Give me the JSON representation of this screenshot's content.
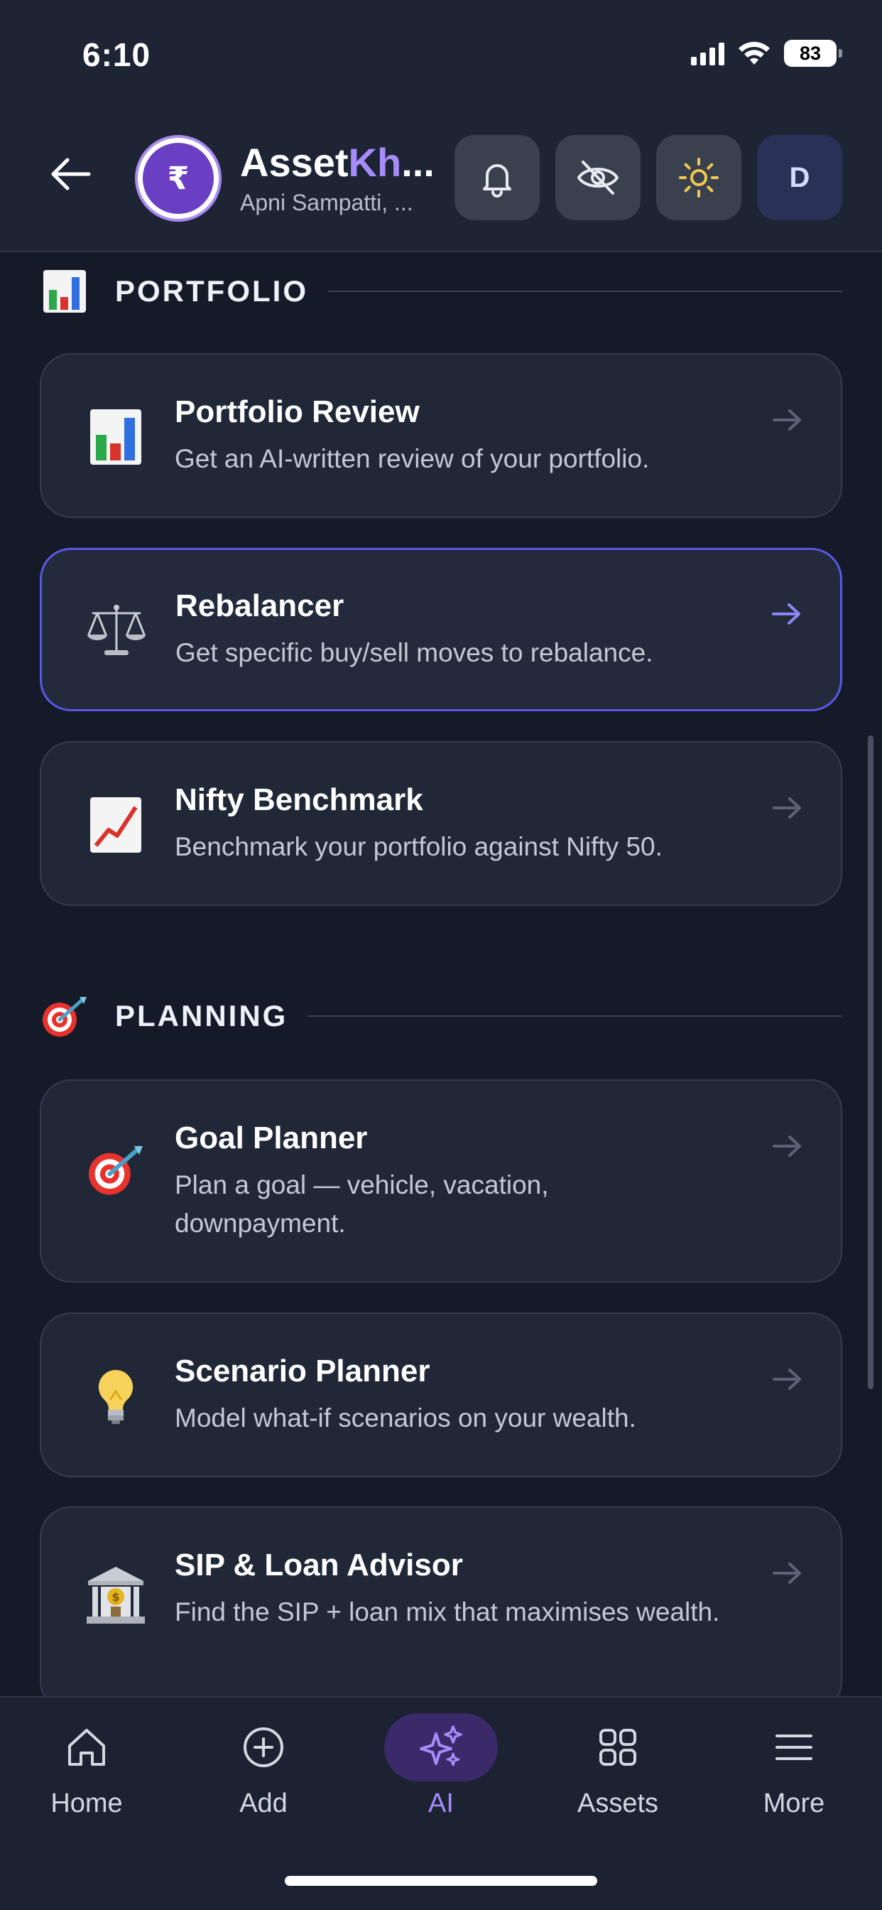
{
  "status_bar": {
    "time": "6:10",
    "battery": "83"
  },
  "header": {
    "brand_part1": "Asset",
    "brand_part2": "Kh",
    "brand_ellipsis": "...",
    "tagline": "Apni Sampatti, ...",
    "logo_text": "₹",
    "avatar_initial": "D"
  },
  "sections": [
    {
      "title": "PORTFOLIO",
      "icon": "bar-chart-icon",
      "cards": [
        {
          "title": "Portfolio Review",
          "desc": "Get an AI-written review of your portfolio.",
          "icon": "bar-chart-icon"
        },
        {
          "title": "Rebalancer",
          "desc": "Get specific buy/sell moves to rebalance.",
          "icon": "balance-scale-icon"
        },
        {
          "title": "Nifty Benchmark",
          "desc": "Benchmark your portfolio against Nifty 50.",
          "icon": "trend-up-chart-icon"
        }
      ]
    },
    {
      "title": "PLANNING",
      "icon": "target-dart-icon",
      "cards": [
        {
          "title": "Goal Planner",
          "desc": "Plan a goal — vehicle, vacation, downpayment.",
          "icon": "target-dart-icon"
        },
        {
          "title": "Scenario Planner",
          "desc": "Model what-if scenarios on your wealth.",
          "icon": "light-bulb-icon"
        },
        {
          "title": "SIP & Loan Advisor",
          "desc": "Find the SIP + loan mix that maximises wealth.",
          "icon": "bank-icon"
        }
      ]
    }
  ],
  "nav": [
    {
      "label": "Home",
      "icon": "home-icon"
    },
    {
      "label": "Add",
      "icon": "plus-circle-icon"
    },
    {
      "label": "AI",
      "icon": "sparkles-icon",
      "active": true
    },
    {
      "label": "Assets",
      "icon": "grid-icon"
    },
    {
      "label": "More",
      "icon": "menu-icon"
    }
  ],
  "colors": {
    "accent": "#a78bfa",
    "active_border": "#5b57e6",
    "background": "#141a28",
    "card": "#202838"
  }
}
